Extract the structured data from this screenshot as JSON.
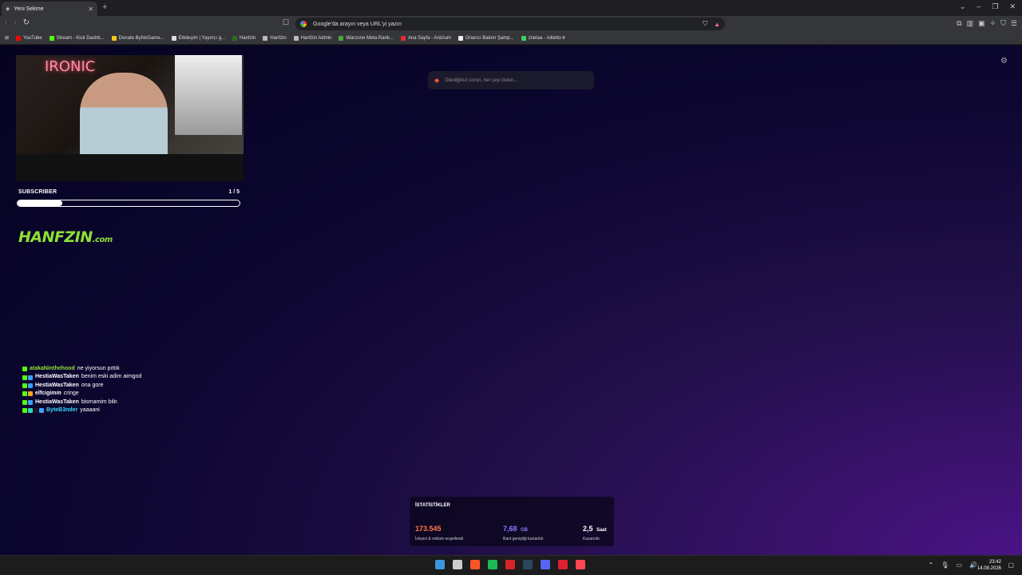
{
  "browser": {
    "tab": {
      "title": "Yeni Sekme"
    },
    "omnibox": {
      "placeholder": "Google'da arayın veya URL'yi yazın"
    },
    "bookmarks": [
      {
        "label": "YouTube",
        "color": "#ff0000"
      },
      {
        "label": "Stream - Kick Dashb...",
        "color": "#53fc18"
      },
      {
        "label": "Donate ByNoGame...",
        "color": "#f5c518"
      },
      {
        "label": "Etkileşim | Yayıncı g...",
        "color": "#dddddd"
      },
      {
        "label": "Hanfzin",
        "color": "#2b6e1f"
      },
      {
        "label": "Hanfzin",
        "color": "#bbbbbb"
      },
      {
        "label": "Hanfzin Admin",
        "color": "#bbbbbb"
      },
      {
        "label": "Warzone Meta Rank...",
        "color": "#4ca832"
      },
      {
        "label": "Ana Sayfa - Anizium",
        "color": "#e03030"
      },
      {
        "label": "Onarıcı Bakım Şamp...",
        "color": "#eeeeee"
      },
      {
        "label": "znelaa - rolletto-tr",
        "color": "#3ecf5e"
      }
    ]
  },
  "overlay": {
    "subscriber_label": "SUBSCRIBER",
    "subscriber_count": "1 / 5",
    "subscriber_progress": 0.2,
    "logo_main": "HANFZIN",
    "logo_tld": ".com",
    "cam_sign": "IRONIC",
    "chat": [
      {
        "user": "atakaNinthehood",
        "color": "#8de035",
        "message": "ne yiyorsun pıttık",
        "badges": [
          "#53fc18"
        ]
      },
      {
        "user": "HestiaWasTaken",
        "color": "#ffffff",
        "message": "benim eski adim aimgod",
        "badges": [
          "#53fc18",
          "#3aa0ff"
        ]
      },
      {
        "user": "HestiaWasTaken",
        "color": "#ffffff",
        "message": "ona gore",
        "badges": [
          "#53fc18",
          "#3aa0ff"
        ]
      },
      {
        "user": "elfcigimm",
        "color": "#ffffff",
        "message": "cringe",
        "badges": [
          "#53fc18",
          "#f5a623"
        ]
      },
      {
        "user": "HestiaWasTaken",
        "color": "#ffffff",
        "message": "bismamim bilir.",
        "badges": [
          "#53fc18",
          "#3aa0ff"
        ]
      },
      {
        "user": "ByteB3nder",
        "color": "#3ad9ff",
        "message": "yaaaani",
        "badges": [
          "#53fc18",
          "#2ad4c4",
          "#1a1a1a",
          "#3aa0ff"
        ]
      }
    ]
  },
  "newtab": {
    "search_placeholder": "Dilediğinizi sorun, her şeyi bulun...",
    "stats": {
      "title": "İSTATİSTİKLER",
      "blocked_value": "173.545",
      "blocked_label": "İzleyici & reklam engellendi",
      "bandwidth_value": "7,68",
      "bandwidth_unit": "GB",
      "bandwidth_label": "Bant genişliği kurtarıldı",
      "time_value": "2,5",
      "time_unit": "Saat",
      "time_label": "Kazanıldı",
      "colors": {
        "blocked": "#ff7a45",
        "bandwidth": "#8b7cff",
        "time": "#ffffff"
      }
    }
  },
  "taskbar": {
    "time": "23:42",
    "date": "14.08.2026",
    "apps": [
      {
        "name": "windows-start",
        "color": "#3a96dd"
      },
      {
        "name": "search",
        "color": "#cccccc"
      },
      {
        "name": "brave",
        "color": "#fb542b"
      },
      {
        "name": "spotify",
        "color": "#1db954"
      },
      {
        "name": "news",
        "color": "#d8232a"
      },
      {
        "name": "steam",
        "color": "#2a475e"
      },
      {
        "name": "discord",
        "color": "#5865f2"
      },
      {
        "name": "app-red",
        "color": "#e02030"
      },
      {
        "name": "valorant",
        "color": "#ff4655"
      }
    ]
  }
}
